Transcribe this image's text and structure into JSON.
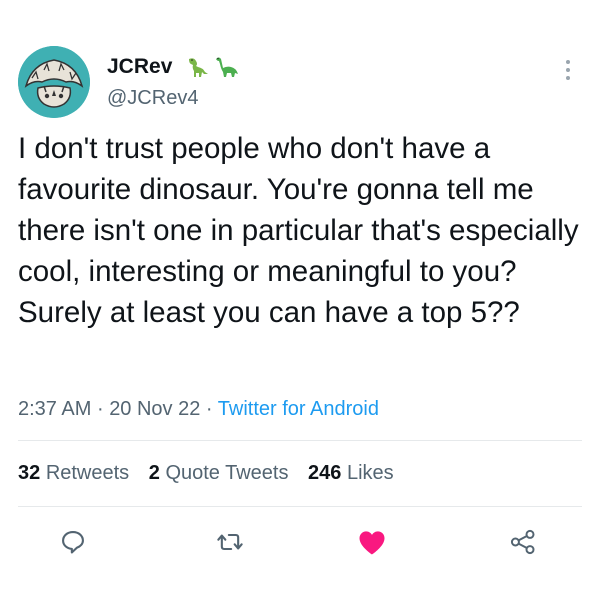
{
  "tweet": {
    "author": {
      "display_name": "JCRev",
      "handle": "@JCRev4",
      "name_emojis": [
        "t-rex-emoji",
        "sauropod-emoji"
      ]
    },
    "text": "I don't trust people who don't have a favourite dinosaur. You're gonna tell me there isn't one in particular that's especially cool, interesting or meaningful to you? Surely at least you can have a top 5??",
    "time": "2:37 AM",
    "date": "20 Nov 22",
    "separator": "·",
    "source": "Twitter for Android",
    "stats": {
      "retweets_count": "32",
      "retweets_label": "Retweets",
      "quotes_count": "2",
      "quotes_label": "Quote Tweets",
      "likes_count": "246",
      "likes_label": "Likes"
    },
    "actions": [
      "reply-icon",
      "retweet-icon",
      "like-icon",
      "share-icon"
    ]
  },
  "colors": {
    "text": "#0f1419",
    "secondary": "#536471",
    "link": "#1d9bf0",
    "like": "#f91880",
    "avatar_bg": "#3fb0b3"
  }
}
